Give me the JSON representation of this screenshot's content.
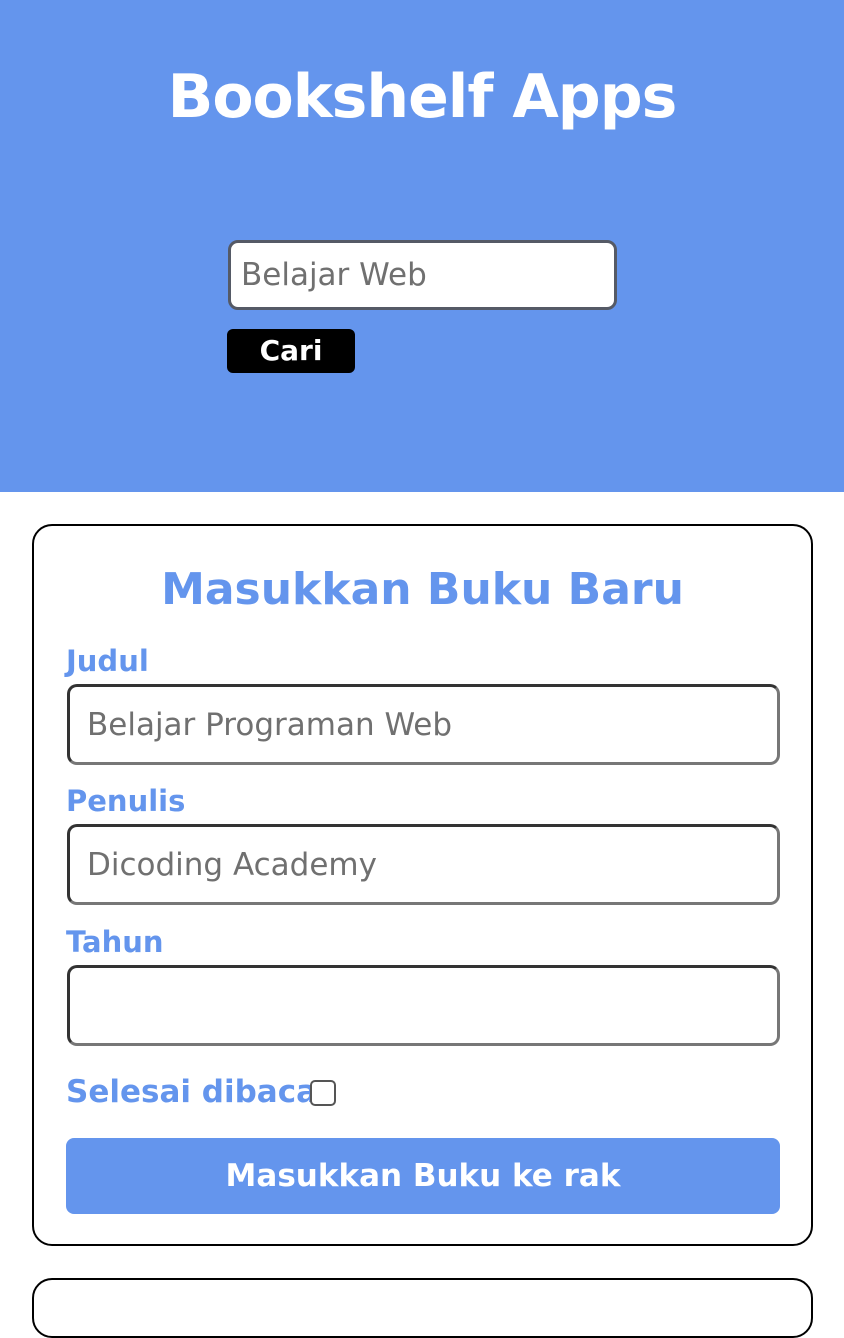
{
  "header": {
    "title": "Bookshelf Apps",
    "search_placeholder": "Belajar Web",
    "search_button": "Cari"
  },
  "form": {
    "title": "Masukkan Buku Baru",
    "fields": [
      {
        "label": "Judul",
        "placeholder": "Belajar Programan Web",
        "value": ""
      },
      {
        "label": "Penulis",
        "placeholder": "Dicoding Academy",
        "value": ""
      },
      {
        "label": "Tahun",
        "placeholder": "",
        "value": ""
      }
    ],
    "complete_label": "Selesai dibaca",
    "complete_checked": false,
    "submit_label": "Masukkan Buku ke rak"
  },
  "colors": {
    "primary": "#6495ed",
    "button_dark": "#000000",
    "text_light": "#ffffff"
  }
}
